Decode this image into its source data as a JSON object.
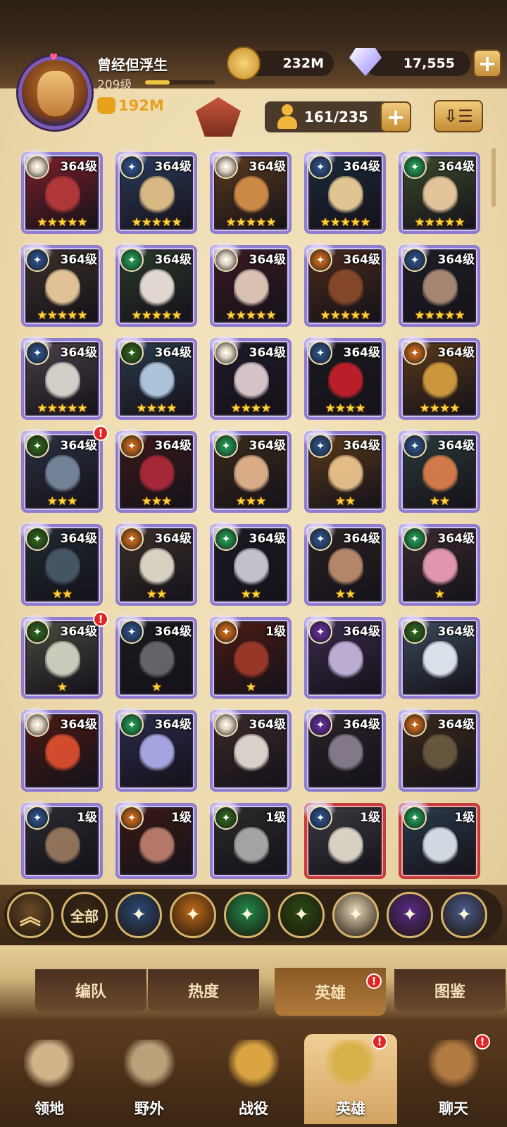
{
  "player": {
    "name": "曾经但浮生",
    "level": "209级",
    "xp_fraction": 0.35,
    "power": "192M"
  },
  "resources": {
    "gold": "232M",
    "diamonds": "17,555"
  },
  "roster": {
    "count": "161/235"
  },
  "heroes": [
    {
      "level": "364级",
      "stars": "★★★★★",
      "faction": "celestial",
      "art": "#7a1f2a",
      "face": "#b83a3a"
    },
    {
      "level": "364级",
      "stars": "★★★★★",
      "faction": "lightbearer",
      "art": "#2a3a5a",
      "face": "#e8c58a"
    },
    {
      "level": "364级",
      "stars": "★★★★★",
      "faction": "celestial",
      "art": "#5a3a1c",
      "face": "#d9924a"
    },
    {
      "level": "364级",
      "stars": "★★★★★",
      "faction": "lightbearer",
      "art": "#1a2a3a",
      "face": "#f1d29a"
    },
    {
      "level": "364级",
      "stars": "★★★★★",
      "faction": "wilder",
      "art": "#3a4a2a",
      "face": "#f3d0a4"
    },
    {
      "level": "364级",
      "stars": "★★★★★",
      "faction": "lightbearer",
      "art": "#3a3028",
      "face": "#f0d0a0"
    },
    {
      "level": "364级",
      "stars": "★★★★★",
      "faction": "wilder",
      "art": "#2a3a2a",
      "face": "#f2e6e0"
    },
    {
      "level": "364级",
      "stars": "★★★★★",
      "faction": "celestial",
      "art": "#3a1a22",
      "face": "#e8d0c0"
    },
    {
      "level": "364级",
      "stars": "★★★★★",
      "faction": "mauler",
      "art": "#4a2a1a",
      "face": "#8a4a2a"
    },
    {
      "level": "364级",
      "stars": "★★★★★",
      "faction": "lightbearer",
      "art": "#1e1e24",
      "face": "#b09078"
    },
    {
      "level": "364级",
      "stars": "★★★★★",
      "faction": "lightbearer",
      "art": "#4a4048",
      "face": "#e0ddd6"
    },
    {
      "level": "364级",
      "stars": "★★★★",
      "faction": "graveborn",
      "art": "#2a3a4a",
      "face": "#b8d0e8"
    },
    {
      "level": "364级",
      "stars": "★★★★",
      "faction": "celestial",
      "art": "#1e1a2a",
      "face": "#e6d2d6"
    },
    {
      "level": "364级",
      "stars": "★★★★",
      "faction": "lightbearer",
      "art": "#1a1a1e",
      "face": "#c8202a"
    },
    {
      "level": "364级",
      "stars": "★★★★",
      "faction": "mauler",
      "art": "#5a3a1a",
      "face": "#d8a040"
    },
    {
      "level": "364级",
      "stars": "★★★",
      "faction": "graveborn",
      "art": "#2a3040",
      "face": "#7a8aa0",
      "alert": "!"
    },
    {
      "level": "364级",
      "stars": "★★★",
      "faction": "mauler",
      "art": "#3a1a1a",
      "face": "#b02a3a"
    },
    {
      "level": "364级",
      "stars": "★★★",
      "faction": "wilder",
      "art": "#3a2a1a",
      "face": "#e8b890"
    },
    {
      "level": "364级",
      "stars": "★★",
      "faction": "lightbearer",
      "art": "#5a3a1a",
      "face": "#f0c890"
    },
    {
      "level": "364级",
      "stars": "★★",
      "faction": "lightbearer",
      "art": "#2a3a3a",
      "face": "#e0804a"
    },
    {
      "level": "364级",
      "stars": "★★",
      "faction": "graveborn",
      "art": "#1e2a30",
      "face": "#4a5a6a"
    },
    {
      "level": "364级",
      "stars": "★★",
      "faction": "mauler",
      "art": "#3a3028",
      "face": "#e8e0d0"
    },
    {
      "level": "364级",
      "stars": "★★",
      "faction": "wilder",
      "art": "#1a1a22",
      "face": "#d0d0d8"
    },
    {
      "level": "364级",
      "stars": "★★",
      "faction": "lightbearer",
      "art": "#2a2220",
      "face": "#c09070"
    },
    {
      "level": "364级",
      "stars": "★",
      "faction": "wilder",
      "art": "#3a2a30",
      "face": "#f0a0b8"
    },
    {
      "level": "364级",
      "stars": "★",
      "faction": "graveborn",
      "art": "#4a4a40",
      "face": "#d8d8c8",
      "alert": "!"
    },
    {
      "level": "364级",
      "stars": "★",
      "faction": "lightbearer",
      "art": "#1a1a1e",
      "face": "#6a6a70"
    },
    {
      "level": "1级",
      "stars": "★",
      "faction": "mauler",
      "art": "#4a1a14",
      "face": "#a03a2a"
    },
    {
      "level": "364级",
      "stars": "",
      "faction": "hypogean",
      "art": "#3a2a4a",
      "face": "#c8b8e0"
    },
    {
      "level": "364级",
      "stars": "",
      "faction": "graveborn",
      "art": "#3a4a5a",
      "face": "#e8f0f8"
    },
    {
      "level": "364级",
      "stars": "",
      "faction": "celestial",
      "art": "#4a1a14",
      "face": "#e05030"
    },
    {
      "level": "364级",
      "stars": "",
      "faction": "wilder",
      "art": "#2a2a4a",
      "face": "#b0b0f0"
    },
    {
      "level": "364级",
      "stars": "",
      "faction": "celestial",
      "art": "#3a2a28",
      "face": "#e8e0d8"
    },
    {
      "level": "364级",
      "stars": "",
      "faction": "hypogean",
      "art": "#2a2228",
      "face": "#8a8090"
    },
    {
      "level": "364级",
      "stars": "",
      "faction": "mauler",
      "art": "#3a2a1a",
      "face": "#6a5a40"
    },
    {
      "level": "1级",
      "stars": "",
      "faction": "lightbearer",
      "art": "#2a2a2e",
      "face": "#9a7a60"
    },
    {
      "level": "1级",
      "stars": "",
      "faction": "mauler",
      "art": "#3a1a14",
      "face": "#c08070"
    },
    {
      "level": "1级",
      "stars": "",
      "faction": "graveborn",
      "art": "#2a2a2a",
      "face": "#b0b0b0"
    },
    {
      "level": "1级",
      "stars": "",
      "faction": "lightbearer",
      "art": "#3a3a40",
      "face": "#e8e0d0",
      "border": "red"
    },
    {
      "level": "1级",
      "stars": "",
      "faction": "wilder",
      "art": "#2a3a4a",
      "face": "#e0e8f0",
      "border": "red"
    }
  ],
  "faction_colors": {
    "lightbearer": "#2a4a7a",
    "mauler": "#b8601a",
    "wilder": "#1f8a4a",
    "graveborn": "#2a5a1a",
    "celestial": "#e8dcc8",
    "hypogean": "#5a2a8a",
    "dimensional": "#3a4a8a"
  },
  "filter": {
    "buttons": [
      {
        "name": "collapse-button",
        "label": "",
        "icon": "chevron-up-icon",
        "color": "#6a4a28"
      },
      {
        "name": "filter-all",
        "label": "全部",
        "icon": "",
        "color": "#3a2a18"
      },
      {
        "name": "filter-lightbearer",
        "label": "",
        "icon": "lightbearer-icon",
        "color": "#2a4a7a"
      },
      {
        "name": "filter-mauler",
        "label": "",
        "icon": "mauler-icon",
        "color": "#c06a1a"
      },
      {
        "name": "filter-wilder",
        "label": "",
        "icon": "wilder-icon",
        "color": "#1f8a4a"
      },
      {
        "name": "filter-graveborn",
        "label": "",
        "icon": "graveborn-icon",
        "color": "#2a4a14"
      },
      {
        "name": "filter-celestial",
        "label": "",
        "icon": "celestial-icon",
        "color": "#e8d8b8"
      },
      {
        "name": "filter-hypogean",
        "label": "",
        "icon": "hypogean-icon",
        "color": "#5a2a8a"
      },
      {
        "name": "filter-dimensional",
        "label": "",
        "icon": "dimensional-icon",
        "color": "#4a5a8a"
      }
    ]
  },
  "tabs": [
    {
      "label": "编队",
      "active": false
    },
    {
      "label": "热度",
      "active": false
    },
    {
      "label": "英雄",
      "active": true,
      "alert": "!"
    },
    {
      "label": "图鉴",
      "active": false
    }
  ],
  "nav": [
    {
      "label": "领地",
      "icon": "castle-icon",
      "active": false
    },
    {
      "label": "野外",
      "icon": "scroll-map-icon",
      "active": false
    },
    {
      "label": "战役",
      "icon": "crossed-swords-icon",
      "active": false
    },
    {
      "label": "英雄",
      "icon": "helmet-icon",
      "active": true,
      "alert": "!"
    },
    {
      "label": "聊天",
      "icon": "chat-icon",
      "active": false,
      "alert": "!"
    }
  ]
}
